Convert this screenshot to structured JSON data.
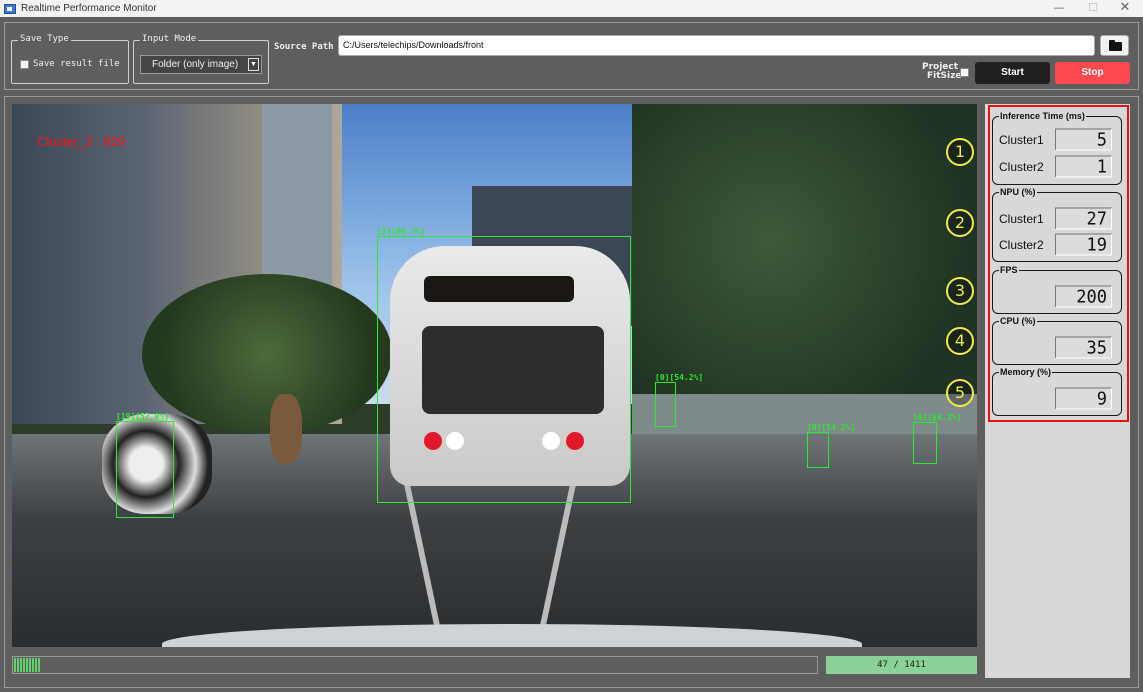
{
  "window": {
    "title": "Realtime Performance Monitor",
    "min_glyph": "—",
    "max_glyph": "☐",
    "close_glyph": "✕"
  },
  "toolbar": {
    "save_type": {
      "legend": "Save Type",
      "checkbox_label": "Save result file",
      "checked": false
    },
    "input_mode": {
      "legend": "Input Mode",
      "selected": "Folder (only image)"
    },
    "source_path": {
      "label": "Source Path",
      "value": "C:/Users/telechips/Downloads/front"
    },
    "project_fitsize": {
      "label_line1": "Project",
      "label_line2": "FitSize",
      "checked": false
    },
    "start_label": "Start",
    "stop_label": "Stop",
    "colors": {
      "stop": "#ff4a50",
      "start": "#202020"
    }
  },
  "video": {
    "overlay_text": "Cluster_2 : 829",
    "detections": [
      {
        "label": "[5][96.7%]"
      },
      {
        "label": "[19][57.0%]"
      },
      {
        "label": "[0][54.2%]"
      },
      {
        "label": "[0][54.2%]"
      },
      {
        "label": "[0][88.3%]"
      }
    ]
  },
  "progress": {
    "fraction": 0.0333,
    "counter": "47 / 1411"
  },
  "metrics": {
    "inference_time": {
      "title": "Inference Time (ms)",
      "cluster1_label": "Cluster1",
      "cluster1": "5",
      "cluster2_label": "Cluster2",
      "cluster2": "1"
    },
    "npu": {
      "title": "NPU (%)",
      "cluster1_label": "Cluster1",
      "cluster1": "27",
      "cluster2_label": "Cluster2",
      "cluster2": "19"
    },
    "fps": {
      "title": "FPS",
      "value": "200"
    },
    "cpu": {
      "title": "CPU (%)",
      "value": "35"
    },
    "memory": {
      "title": "Memory (%)",
      "value": "9"
    }
  },
  "badges": [
    "1",
    "2",
    "3",
    "4",
    "5"
  ],
  "accent_colors": {
    "highlight_frame": "#ee1010",
    "bbox": "#2ee82e",
    "badge": "#f2e84a"
  }
}
